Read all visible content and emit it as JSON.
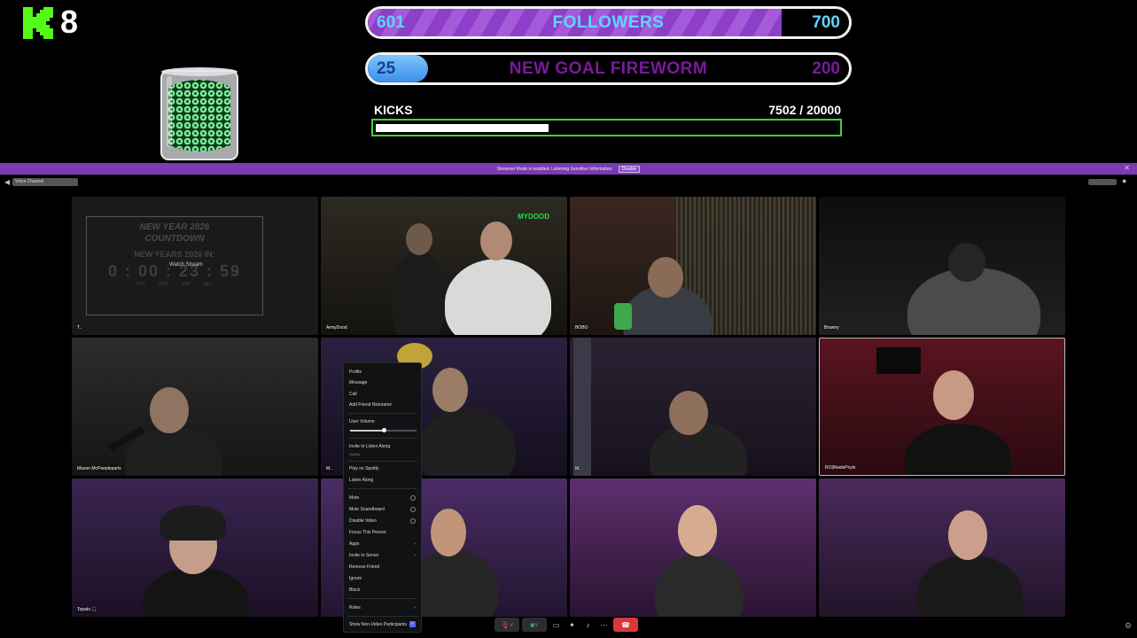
{
  "overlay": {
    "kick_count": "8",
    "followers_goal": {
      "current": "601",
      "label": "FOLLOWERS",
      "target": "700",
      "progress": 0.86
    },
    "fireworm_goal": {
      "current": "25",
      "label": "NEW GOAL FIREWORM",
      "target": "200",
      "progress": 0.125
    },
    "kicks": {
      "label": "KICKS",
      "value": "7502  / 20000",
      "progress": 0.375
    }
  },
  "banner": {
    "text": "Streamer Mode is enabled. Listening Sensitive Information.",
    "disable_label": "Disable"
  },
  "call_header": {
    "channel": "Voice Channel"
  },
  "tiles": [
    {
      "name": "T..",
      "watch_label": "Watch Stream",
      "countdown": {
        "title": "NEW YEAR 2026\nCOUNTDOWN",
        "subtitle": "NEW YEARS 2026 IN:",
        "time": "0 : 00 : 23 : 59",
        "units": "DAY HRS MIN SEC"
      }
    },
    {
      "name": "ArmyDood"
    },
    {
      "name": "BOBO"
    },
    {
      "name": "Brawny"
    },
    {
      "name": "Mason McPeepleparts"
    },
    {
      "name": "M.."
    },
    {
      "name": "M.."
    },
    {
      "name": "RO|MaidsPoyls"
    },
    {
      "name": "Topato 🎧"
    },
    {
      "name": ""
    },
    {
      "name": ""
    },
    {
      "name": ""
    }
  ],
  "context_menu": {
    "items": [
      "Profile",
      "Message",
      "Call",
      "Add Friend Nickname",
      "User Volume",
      "Invite to Listen Along",
      "Spotify",
      "Play on Spotify",
      "Listen Along",
      "Mute",
      "Mute Soundboard",
      "Disable Video",
      "Focus This Person",
      "Apps",
      "Invite to Server",
      "Remove Friend",
      "Ignore",
      "Block",
      "Roles",
      "Show Non-Video Participants"
    ],
    "user_volume_percent": 50
  },
  "colors": {
    "banner": "#7b3bb3",
    "followers_fill": "#a55ad8",
    "followers_text": "#5fd4ff",
    "fireworm_fill": "#3b8ee8",
    "fireworm_text": "#7a1a9c",
    "kicks_border": "#38d43a",
    "kick_logo": "#53fc18",
    "hangup": "#da373c"
  },
  "icons": {
    "kick_logo": "kick-logo",
    "volume": "speaker-icon",
    "chat": "chat-bubble-icon",
    "mic": "microphone-muted-icon",
    "camera": "camera-icon",
    "screenshare": "screen-share-icon",
    "activities": "activities-icon",
    "soundboard": "soundboard-icon",
    "more": "more-dots-icon",
    "hangup": "phone-hangup-icon",
    "settings": "gear-icon"
  }
}
